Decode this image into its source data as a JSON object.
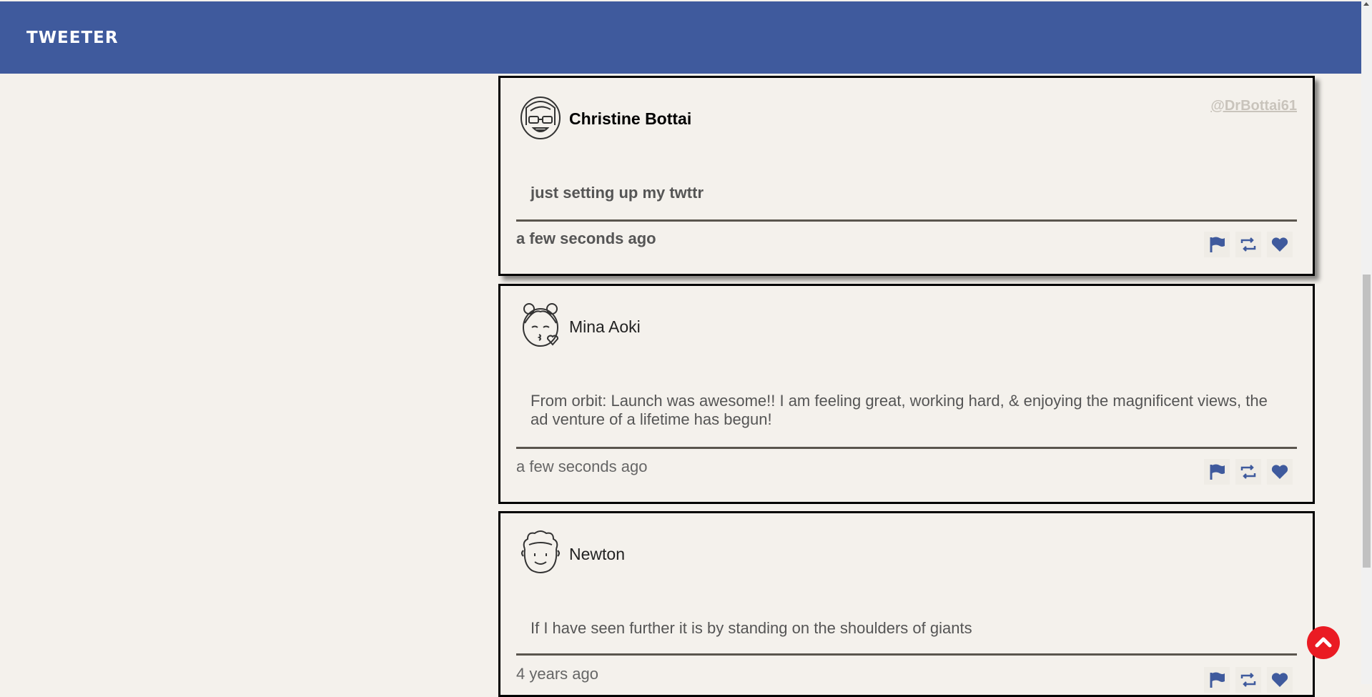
{
  "brand": "TWEETER",
  "colors": {
    "primary": "#3f5a9d",
    "background": "#f4f1ec",
    "fab": "#ea1b23"
  },
  "tweets": [
    {
      "name": "Christine Bottai",
      "handle": "@DrBottai61",
      "content": "just setting up my twttr",
      "time": "a few seconds ago",
      "avatar_icon": "avatar-glasses-woman-icon"
    },
    {
      "name": "Mina Aoki",
      "content": "From orbit: Launch was awesome!! I am feeling great, working hard, & enjoying the magnificent views, the ad venture of a lifetime has begun!",
      "time": "a few seconds ago",
      "avatar_icon": "avatar-girl-kiss-icon"
    },
    {
      "name": "Newton",
      "content": "If I have seen further it is by standing on the shoulders of giants",
      "time": "4 years ago",
      "avatar_icon": "avatar-curly-man-icon"
    }
  ],
  "actions": [
    "flag-icon",
    "retweet-icon",
    "heart-icon"
  ],
  "fab_icon": "scroll-to-top-icon"
}
